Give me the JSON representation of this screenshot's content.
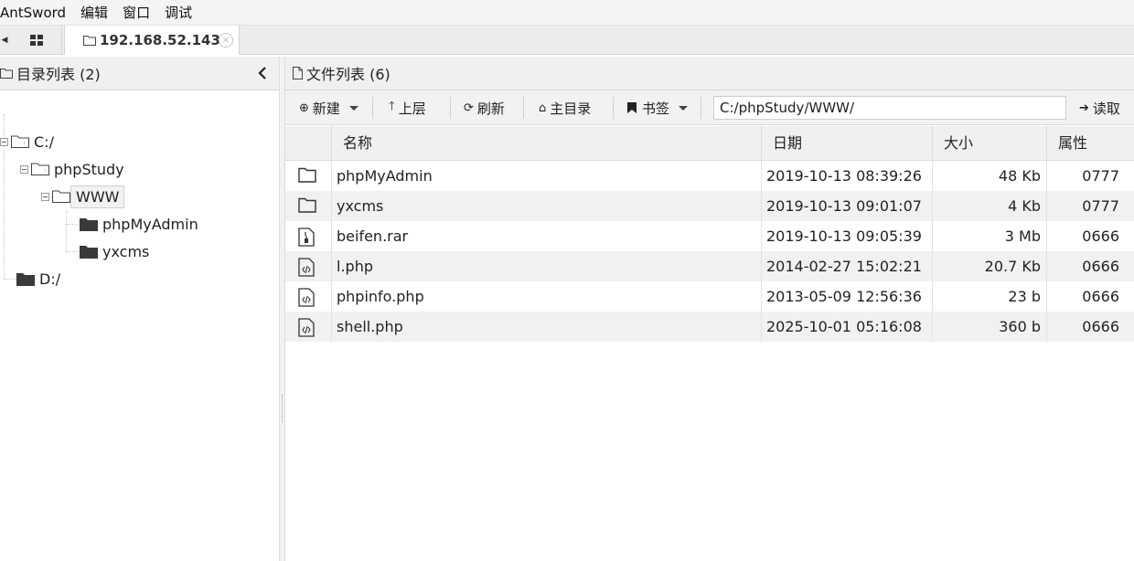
{
  "menu": [
    "AntSword",
    "编辑",
    "窗口",
    "调试"
  ],
  "tabs": {
    "active_title": "192.168.52.143",
    "close_glyph": "×"
  },
  "left_panel": {
    "header": "目录列表 (2)",
    "tree": {
      "c_drive": "C:/",
      "phpstudy": "phpStudy",
      "www": "WWW",
      "phpmyadmin": "phpMyAdmin",
      "yxcms": "yxcms",
      "d_drive": "D:/"
    }
  },
  "right_panel": {
    "header": "文件列表 (6)",
    "toolbar": {
      "new_label": "新建",
      "up_label": "上层",
      "refresh_label": "刷新",
      "home_label": "主目录",
      "bookmark_label": "书签",
      "path_value": "C:/phpStudy/WWW/",
      "read_label": "读取"
    },
    "columns": {
      "name": "名称",
      "date": "日期",
      "size": "大小",
      "attr": "属性"
    },
    "files": [
      {
        "icon": "folder-icon",
        "name": "phpMyAdmin",
        "date": "2019-10-13 08:39:26",
        "size": "48 Kb",
        "attr": "0777"
      },
      {
        "icon": "folder-icon",
        "name": "yxcms",
        "date": "2019-10-13 09:01:07",
        "size": "4 Kb",
        "attr": "0777"
      },
      {
        "icon": "archive-file-icon",
        "name": "beifen.rar",
        "date": "2019-10-13 09:05:39",
        "size": "3 Mb",
        "attr": "0666"
      },
      {
        "icon": "code-file-icon",
        "name": "l.php",
        "date": "2014-02-27 15:02:21",
        "size": "20.7 Kb",
        "attr": "0666"
      },
      {
        "icon": "code-file-icon",
        "name": "phpinfo.php",
        "date": "2013-05-09 12:56:36",
        "size": "23 b",
        "attr": "0666"
      },
      {
        "icon": "code-file-icon",
        "name": "shell.php",
        "date": "2025-10-01 05:16:08",
        "size": "360 b",
        "attr": "0666"
      }
    ]
  }
}
